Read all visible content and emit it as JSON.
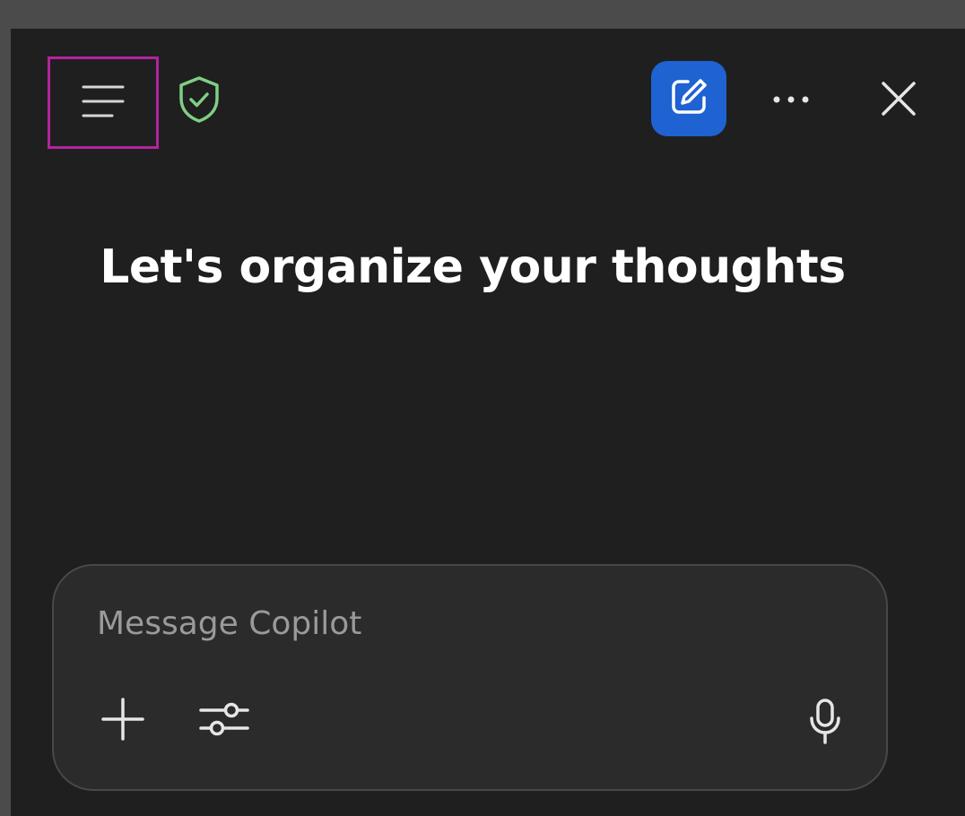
{
  "header": {
    "icons": {
      "menu": "hamburger-menu-icon",
      "shield": "shield-check-icon",
      "new_chat": "compose-icon",
      "more": "more-horizontal-icon",
      "close": "close-icon"
    },
    "colors": {
      "highlight_border": "#b3239e",
      "shield": "#7fcf85",
      "new_chat_bg": "#1f62d1"
    }
  },
  "main": {
    "heading": "Let's organize your thoughts"
  },
  "composer": {
    "placeholder": "Message Copilot",
    "value": "",
    "icons": {
      "add": "plus-icon",
      "tools": "sliders-icon",
      "mic": "microphone-icon"
    }
  }
}
